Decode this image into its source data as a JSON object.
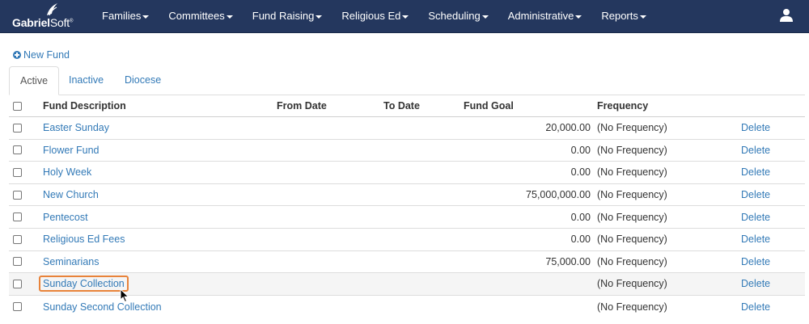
{
  "brand": {
    "name_part1": "Gabri",
    "name_part2": "el",
    "name_part3": "Soft",
    "trademark": "®"
  },
  "nav": {
    "items": [
      {
        "label": "Families",
        "name": "nav-families"
      },
      {
        "label": "Committees",
        "name": "nav-committees"
      },
      {
        "label": "Fund Raising",
        "name": "nav-fund-raising"
      },
      {
        "label": "Religious Ed",
        "name": "nav-religious-ed"
      },
      {
        "label": "Scheduling",
        "name": "nav-scheduling"
      },
      {
        "label": "Administrative",
        "name": "nav-administrative"
      },
      {
        "label": "Reports",
        "name": "nav-reports"
      }
    ],
    "user_icon": "user-icon"
  },
  "toolbar": {
    "new_fund_label": "New Fund",
    "new_fund_icon": "plus-circle-icon"
  },
  "tabs": [
    {
      "label": "Active",
      "active": true
    },
    {
      "label": "Inactive",
      "active": false
    },
    {
      "label": "Diocese",
      "active": false
    }
  ],
  "table": {
    "columns": {
      "description": "Fund Description",
      "from_date": "From Date",
      "to_date": "To Date",
      "goal": "Fund Goal",
      "frequency": "Frequency"
    },
    "rows": [
      {
        "description": "Easter Sunday",
        "from": "",
        "to": "",
        "goal": "20,000.00",
        "frequency": "(No Frequency)",
        "action": "Delete"
      },
      {
        "description": "Flower Fund",
        "from": "",
        "to": "",
        "goal": "0.00",
        "frequency": "(No Frequency)",
        "action": "Delete"
      },
      {
        "description": "Holy Week",
        "from": "",
        "to": "",
        "goal": "0.00",
        "frequency": "(No Frequency)",
        "action": "Delete"
      },
      {
        "description": "New Church",
        "from": "",
        "to": "",
        "goal": "75,000,000.00",
        "frequency": "(No Frequency)",
        "action": "Delete"
      },
      {
        "description": "Pentecost",
        "from": "",
        "to": "",
        "goal": "0.00",
        "frequency": "(No Frequency)",
        "action": "Delete"
      },
      {
        "description": "Religious Ed Fees",
        "from": "",
        "to": "",
        "goal": "0.00",
        "frequency": "(No Frequency)",
        "action": "Delete"
      },
      {
        "description": "Seminarians",
        "from": "",
        "to": "",
        "goal": "75,000.00",
        "frequency": "(No Frequency)",
        "action": "Delete"
      },
      {
        "description": "Sunday Collection",
        "from": "",
        "to": "",
        "goal": "",
        "frequency": "(No Frequency)",
        "action": "Delete"
      },
      {
        "description": "Sunday Second Collection",
        "from": "",
        "to": "",
        "goal": "",
        "frequency": "(No Frequency)",
        "action": "Delete"
      }
    ]
  },
  "colors": {
    "navbar": "#24375e",
    "link": "#337ab7",
    "focus_outline": "#e8833a",
    "hover_row": "#f5f5f5"
  }
}
